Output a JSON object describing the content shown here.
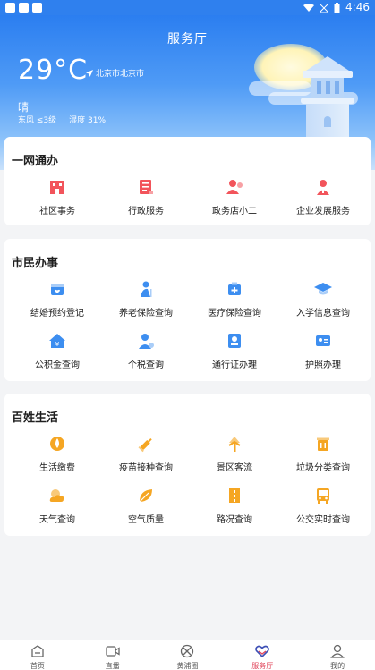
{
  "status_bar": {
    "time": "4:46"
  },
  "header": {
    "title": "服务厅",
    "temperature": "29°C",
    "location": "北京市北京市",
    "weather": "晴",
    "wind": "东风 ≤3级",
    "humidity": "湿度 31%"
  },
  "sections": [
    {
      "title": "一网通办",
      "items": [
        {
          "label": "社区事务",
          "icon": "community-building-icon"
        },
        {
          "label": "行政服务",
          "icon": "document-icon"
        },
        {
          "label": "政务店小二",
          "icon": "assistant-person-icon"
        },
        {
          "label": "企业发展服务",
          "icon": "business-person-icon"
        }
      ]
    },
    {
      "title": "市民办事",
      "items": [
        {
          "label": "结婚预约登记",
          "icon": "marriage-box-icon"
        },
        {
          "label": "养老保险查询",
          "icon": "elderly-person-icon"
        },
        {
          "label": "医疗保险查询",
          "icon": "medical-kit-icon"
        },
        {
          "label": "入学信息查询",
          "icon": "graduation-cap-icon"
        },
        {
          "label": "公积金查询",
          "icon": "house-yen-icon"
        },
        {
          "label": "个税查询",
          "icon": "person-tax-icon"
        },
        {
          "label": "通行证办理",
          "icon": "id-badge-icon"
        },
        {
          "label": "护照办理",
          "icon": "passport-card-icon"
        }
      ]
    },
    {
      "title": "百姓生活",
      "items": [
        {
          "label": "生活缴费",
          "icon": "payment-drop-icon"
        },
        {
          "label": "疫苗接种查询",
          "icon": "syringe-icon"
        },
        {
          "label": "景区客流",
          "icon": "tree-scenic-icon"
        },
        {
          "label": "垃圾分类查询",
          "icon": "trash-bin-icon"
        },
        {
          "label": "天气查询",
          "icon": "weather-cloud-icon"
        },
        {
          "label": "空气质量",
          "icon": "leaf-icon"
        },
        {
          "label": "路况查询",
          "icon": "road-icon"
        },
        {
          "label": "公交实时查询",
          "icon": "bus-icon"
        }
      ]
    }
  ],
  "tabbar": {
    "items": [
      {
        "label": "首页",
        "icon": "home-icon"
      },
      {
        "label": "直播",
        "icon": "video-camera-icon"
      },
      {
        "label": "黄浦圈",
        "icon": "circle-cross-icon"
      },
      {
        "label": "服务厅",
        "icon": "heart-hands-icon",
        "active": true
      },
      {
        "label": "我的",
        "icon": "user-icon"
      }
    ]
  },
  "colors": {
    "brand_blue": "#2f80ee",
    "section1_icon": "#f2545b",
    "section2_icon": "#3d8ef0",
    "section3_icon": "#f5a623",
    "tab_active": "#e0445a"
  }
}
